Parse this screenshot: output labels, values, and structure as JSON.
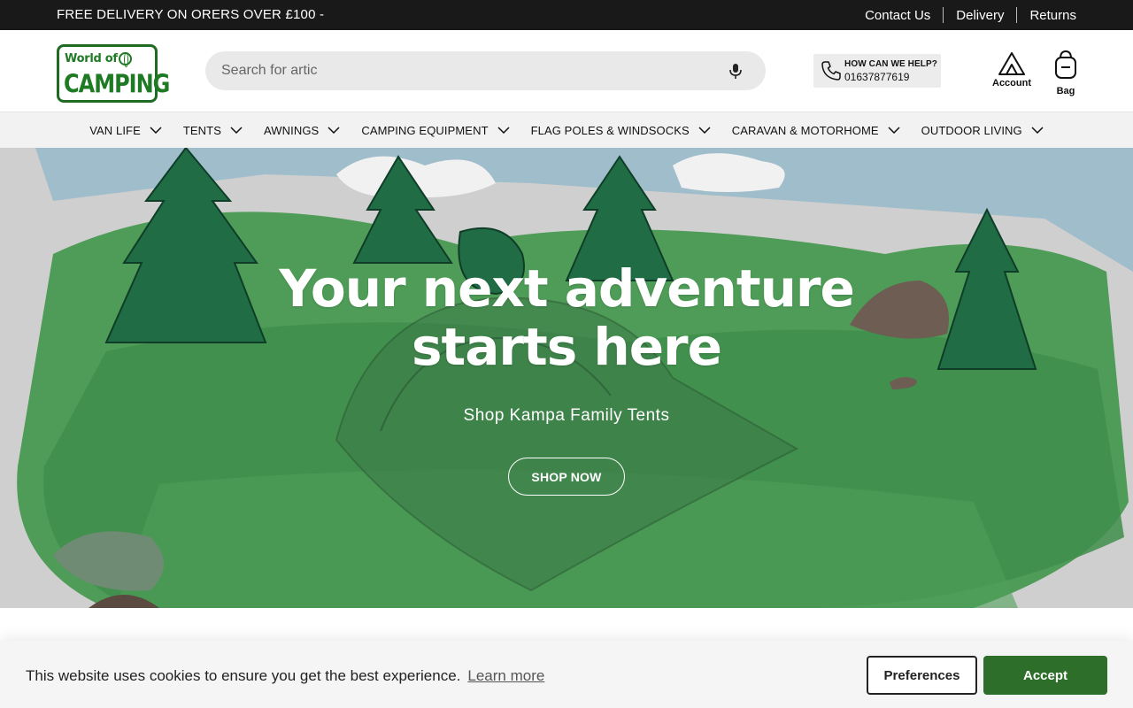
{
  "topbar": {
    "promo": "FREE DELIVERY ON ORERS OVER £100 -",
    "links": [
      "Contact Us",
      "Delivery",
      "Returns"
    ]
  },
  "header": {
    "logo_line1": "World of",
    "logo_line2": "CAMPING",
    "search_placeholder": "Search for artic",
    "help_title": "HOW CAN WE HELP?",
    "help_phone": "01637877619",
    "account_label": "Account",
    "bag_label": "Bag"
  },
  "nav": {
    "items": [
      "VAN LIFE",
      "TENTS",
      "AWNINGS",
      "CAMPING EQUIPMENT",
      "FLAG POLES & WINDSOCKS",
      "CARAVAN & MOTORHOME",
      "OUTDOOR LIVING"
    ]
  },
  "hero": {
    "title_line1": "Your next adventure",
    "title_line2": "starts here",
    "subtitle": "Shop Kampa Family Tents",
    "cta": "SHOP NOW"
  },
  "cookie": {
    "message": "This website uses cookies to ensure you get the best experience.",
    "learn_more": "Learn more",
    "preferences": "Preferences",
    "accept": "Accept"
  },
  "colors": {
    "brand_green": "#1f7a24",
    "accept_green": "#2c6e2a",
    "topbar_bg": "#191919"
  }
}
